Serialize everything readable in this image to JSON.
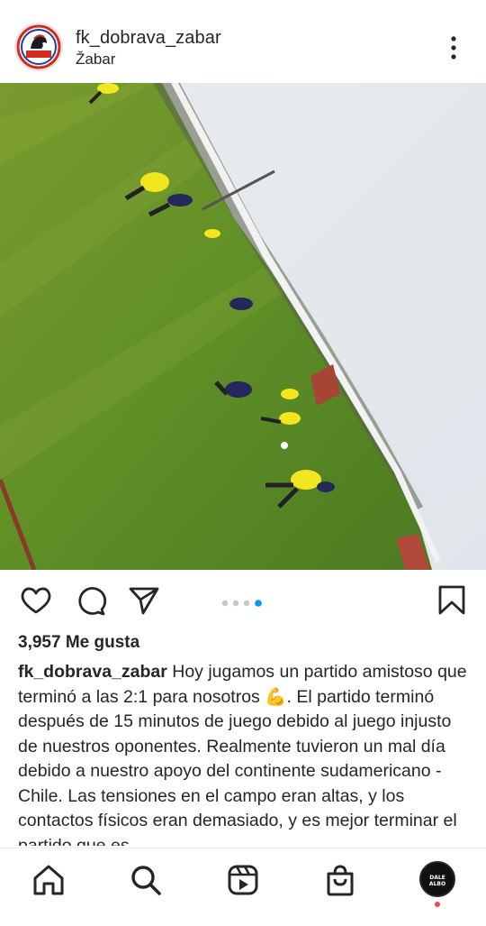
{
  "post": {
    "username": "fk_dobrava_zabar",
    "location": "Žabar",
    "avatar_text": "FK Dobrava",
    "likes_text": "3,957 Me gusta",
    "caption_user": "fk_dobrava_zabar",
    "caption_text": "Hoy jugamos un partido amistoso que terminó a las 2:1 para nosotros 💪. El partido terminó después de 15 minutos de juego debido al juego injusto de nuestros oponentes. Realmente tuvieron un mal día debido a nuestro apoyo del continente sudamericano - Chile. Las tensiones en el campo eran altas, y los contactos físicos eran demasiado, y es mejor terminar el partido que es",
    "carousel": {
      "count": 4,
      "active_index": 3
    },
    "photo_description_icon": "soccer-match-photo"
  },
  "actions": {
    "like_icon": "heart-icon",
    "comment_icon": "comment-icon",
    "share_icon": "send-icon",
    "save_icon": "bookmark-icon"
  },
  "navbar": {
    "items": [
      "home-icon",
      "search-icon",
      "reels-icon",
      "shop-icon",
      "profile-avatar"
    ],
    "profile_text": "DALE ALBO"
  },
  "colors": {
    "text": "#262626",
    "active_dot": "#0095f6",
    "inactive_dot": "#c7c7c7",
    "notification": "#ed4956"
  }
}
